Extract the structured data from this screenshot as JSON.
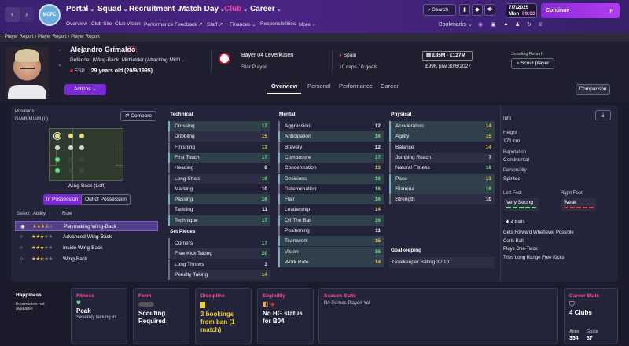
{
  "nav": {
    "menu": [
      "Portal",
      "Squad",
      "Recruitment",
      "Match Day",
      "Club",
      "Career"
    ],
    "active_menu": "Club",
    "sub": [
      "Overview",
      "Club Site",
      "Club Vision",
      "Performance Feedback",
      "Staff",
      "Finances",
      "Responsibilities",
      "More"
    ],
    "search": "Search",
    "date_line1": "7/7/2025",
    "date_line2": "Mon",
    "time": "09:00",
    "continue": "Continue",
    "bookmarks": "Bookmarks",
    "crest_text": "MCFC"
  },
  "breadcrumb": [
    "Player Report",
    "Player Report",
    "Player Report"
  ],
  "player": {
    "name": "Alejandro Grimaldo",
    "number": "20",
    "positions": "Defender (Wing-Back, Midfielder (Attacking Midfi...",
    "nation": "ESP",
    "age": "29 years old (20/9/1995)",
    "club": "Bayer 04 Leverkusen",
    "status": "Star Player",
    "country": "Spain",
    "caps": "10 caps / 0 goals",
    "value": "£85M - £127M",
    "wage": "£99K p/w 30/6/2027",
    "scout_title": "Scouting Report",
    "scout_btn": "Scout player",
    "actions": "Actions"
  },
  "tabs": [
    "Overview",
    "Personal",
    "Performance",
    "Career"
  ],
  "comparison": "Comparison",
  "left": {
    "positions_label": "Positions",
    "positions_val": "D/WB/M/AM (L)",
    "compare": "Compare",
    "role_title": "Wing-Back (Left)",
    "in_pos": "In Possession",
    "out_pos": "Out of Possession",
    "cols": [
      "Select",
      "Ability",
      "Role"
    ],
    "roles": [
      {
        "stars": 3.5,
        "name": "Playmaking Wing-Back"
      },
      {
        "stars": 3,
        "name": "Advanced Wing-Back"
      },
      {
        "stars": 3,
        "name": "Inside Wing-Back"
      },
      {
        "stars": 2.5,
        "name": "Wing-Back"
      }
    ]
  },
  "technical": {
    "title": "Technical",
    "items": [
      [
        "Crossing",
        "17"
      ],
      [
        "Dribbling",
        "15"
      ],
      [
        "Finishing",
        "13"
      ],
      [
        "First Touch",
        "17"
      ],
      [
        "Heading",
        "8"
      ],
      [
        "Long Shots",
        "16"
      ],
      [
        "Marking",
        "10"
      ],
      [
        "Passing",
        "16"
      ],
      [
        "Tackling",
        "11"
      ],
      [
        "Technique",
        "17"
      ]
    ]
  },
  "setpieces": {
    "title": "Set Pieces",
    "items": [
      [
        "Corners",
        "17"
      ],
      [
        "Free Kick Taking",
        "20"
      ],
      [
        "Long Throws",
        "3"
      ],
      [
        "Penalty Taking",
        "14"
      ]
    ]
  },
  "mental": {
    "title": "Mental",
    "items": [
      [
        "Aggression",
        "12"
      ],
      [
        "Anticipation",
        "16"
      ],
      [
        "Bravery",
        "12"
      ],
      [
        "Composure",
        "17"
      ],
      [
        "Concentration",
        "13"
      ],
      [
        "Decisions",
        "16"
      ],
      [
        "Determination",
        "16"
      ],
      [
        "Flair",
        "16"
      ],
      [
        "Leadership",
        "14"
      ],
      [
        "Off The Ball",
        "16"
      ],
      [
        "Positioning",
        "11"
      ],
      [
        "Teamwork",
        "15"
      ],
      [
        "Vision",
        "16"
      ],
      [
        "Work Rate",
        "14"
      ]
    ]
  },
  "physical": {
    "title": "Physical",
    "items": [
      [
        "Acceleration",
        "14"
      ],
      [
        "Agility",
        "15"
      ],
      [
        "Balance",
        "14"
      ],
      [
        "Jumping Reach",
        "7"
      ],
      [
        "Natural Fitness",
        "18"
      ],
      [
        "Pace",
        "13"
      ],
      [
        "Stamina",
        "16"
      ],
      [
        "Strength",
        "10"
      ]
    ]
  },
  "goalkeeping": {
    "title": "Goalkeeping",
    "rating": "Goalkeeper Rating 3 / 10"
  },
  "info": {
    "title": "Info",
    "height_l": "Height",
    "height": "171 cm",
    "rep_l": "Reputation",
    "rep": "Continental",
    "pers_l": "Personality",
    "pers": "Spirited",
    "lf_l": "Left Foot",
    "lf": "Very Strong",
    "rf_l": "Right Foot",
    "rf": "Weak",
    "traits_l": "4 traits",
    "traits": [
      "Gets Forward Whenever Possible",
      "Curls Ball",
      "Plays One-Twos",
      "Tries Long Range Free Kicks"
    ]
  },
  "bottom": {
    "happiness": "Happiness",
    "happiness_s": "Information not available",
    "fitness": "Fitness",
    "fitness_b": "Peak",
    "fitness_s": "Severely lacking in ...",
    "form": "Form",
    "form_b": "Scouting Required",
    "form_badge": "--",
    "discipline": "Discipline",
    "discipline_b": "3 bookings from ban (1 match)",
    "eligibility": "Eligibility",
    "eligibility_b": "No HG status for B04",
    "season": "Season Stats",
    "season_s": "No Games Played Yet",
    "career": "Career Stats",
    "career_b": "4 Clubs",
    "apps_l": "Apps",
    "apps": "354",
    "goals_l": "Goals",
    "goals": "37"
  },
  "colors": {
    "accent": "#ff4d9f",
    "purple": "#7a2ad2",
    "green": "#6fe07a",
    "yellow": "#e0c24a"
  }
}
